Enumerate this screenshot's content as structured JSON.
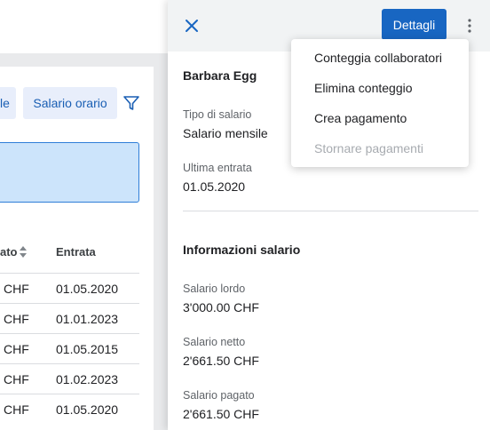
{
  "background": {
    "filter_chip_partial": "le",
    "filter_chip_hourly": "Salario orario",
    "table": {
      "headers": {
        "paid": "ato",
        "entry": "Entrata"
      },
      "rows": [
        {
          "paid": "CHF",
          "entry": "01.05.2020"
        },
        {
          "paid": "CHF",
          "entry": "01.01.2023"
        },
        {
          "paid": "CHF",
          "entry": "01.05.2015"
        },
        {
          "paid": "CHF",
          "entry": "01.02.2023"
        },
        {
          "paid": "CHF",
          "entry": "01.05.2020"
        }
      ]
    }
  },
  "panel": {
    "details_label": "Dettagli",
    "employee_name": "Barbara Egg",
    "salary_type_label": "Tipo di salario",
    "salary_type_value": "Salario mensile",
    "last_entry_label": "Ultima entrata",
    "last_entry_value": "01.05.2020",
    "section_title": "Informazioni salario",
    "gross_label": "Salario lordo",
    "gross_value": "3'000.00 CHF",
    "net_label": "Salario netto",
    "net_value": "2'661.50 CHF",
    "paid_label": "Salario pagato",
    "paid_value": "2'661.50 CHF"
  },
  "menu": {
    "items": [
      {
        "label": "Conteggia collaboratori",
        "enabled": true
      },
      {
        "label": "Elimina conteggio",
        "enabled": true
      },
      {
        "label": "Crea pagamento",
        "enabled": true
      },
      {
        "label": "Stornare pagamenti",
        "enabled": false
      }
    ]
  },
  "colors": {
    "accent": "#1866c2",
    "chip_bg": "#e8eefb",
    "highlight_bg": "#cce4fb",
    "disabled_text": "#a7abb0"
  },
  "icons": [
    "close-icon",
    "kebab-menu-icon",
    "filter-icon",
    "sort-icon"
  ]
}
